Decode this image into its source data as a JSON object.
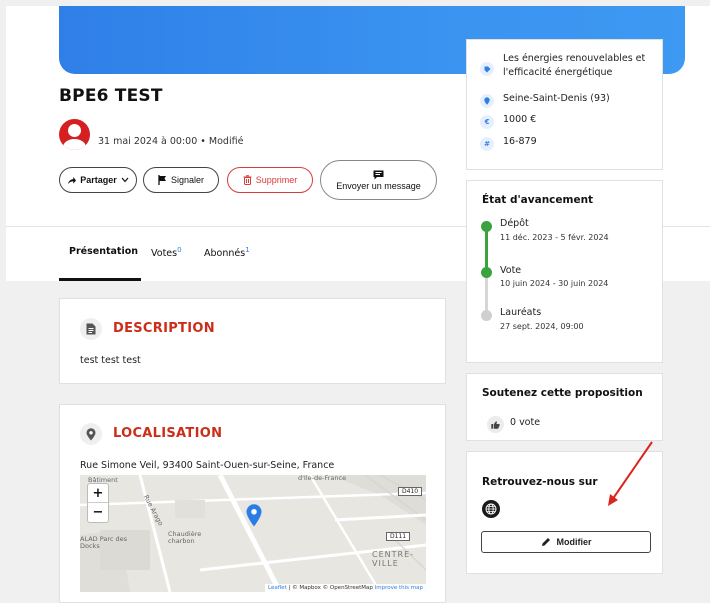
{
  "project": {
    "title": "BPE6 TEST",
    "meta": "31 mai 2024 à 00:00 • Modifié"
  },
  "actions": {
    "share_label": "Partager",
    "report_label": "Signaler",
    "delete_label": "Supprimer",
    "message_label": "Envoyer un message"
  },
  "tabs": [
    {
      "label": "Présentation",
      "count": ""
    },
    {
      "label": "Votes",
      "count": "0"
    },
    {
      "label": "Abonnés",
      "count": "1"
    }
  ],
  "description": {
    "heading": "DESCRIPTION",
    "text": "test test test"
  },
  "location": {
    "heading": "LOCALISATION",
    "address": "Rue Simone Veil, 93400 Saint-Ouen-sur-Seine, France",
    "map": {
      "zoom_in": "+",
      "zoom_out": "−",
      "labels": [
        "Bâtiment",
        "Rue Arago",
        "Chaudière charbon",
        "ALAD Parc des Docks",
        "CENTRE-VILLE",
        "d'Île-de-France"
      ],
      "road_tags": [
        "D410",
        "D111"
      ],
      "attribution_leaflet": "Leaflet",
      "attribution_rest": "| © Mapbox © OpenStreetMap",
      "attribution_improve": "Improve this map"
    }
  },
  "info": {
    "theme": "Les énergies renouvelables et l'efficacité énergétique",
    "area": "Seine-Saint-Denis (93)",
    "budget": "1000 €",
    "reference": "16-879"
  },
  "status": {
    "title": "État d'avancement",
    "steps": [
      {
        "name": "Dépôt",
        "dates": "11 déc. 2023 - 5 févr. 2024",
        "color": "#3aa340"
      },
      {
        "name": "Vote",
        "dates": "10 juin 2024 - 30 juin 2024",
        "color": "#3aa340"
      },
      {
        "name": "Lauréats",
        "dates": "27 sept. 2024, 09:00",
        "color": "#cfcfcf"
      }
    ]
  },
  "support": {
    "title": "Soutenez cette proposition",
    "votes": "0 vote"
  },
  "social": {
    "title": "Retrouvez-nous sur",
    "edit_label": "Modifier"
  },
  "colors": {
    "accent_blue": "#2f7fe8",
    "danger_red": "#cc2d18",
    "progress_green": "#3aa340",
    "arrow_red": "#d9261c"
  },
  "icons": [
    "share-icon",
    "chevron-down-icon",
    "flag-icon",
    "trash-icon",
    "chat-icon",
    "document-icon",
    "location-pin-icon",
    "tag-icon",
    "euro-icon",
    "hash-icon",
    "thumbs-up-icon",
    "globe-icon",
    "pencil-icon",
    "map-marker-icon"
  ]
}
